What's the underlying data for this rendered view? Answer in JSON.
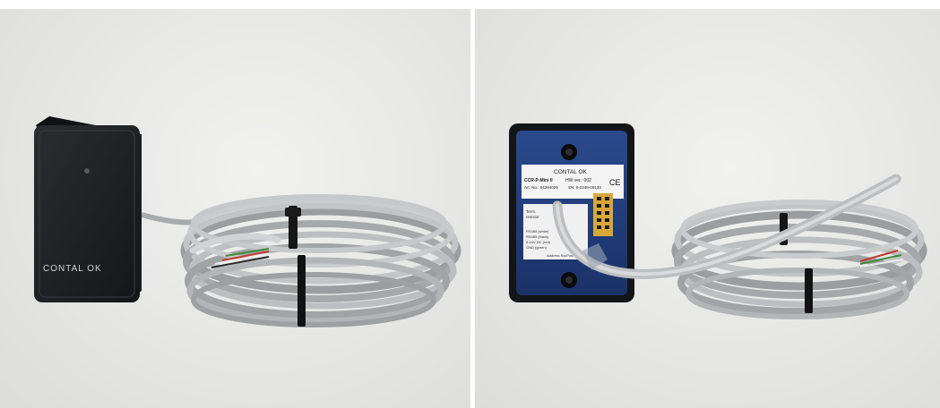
{
  "photo_left": {
    "brand_text": "CONTAL OK"
  },
  "photo_right": {
    "brand_text": "CONTAL OK",
    "label": {
      "model": "CCR-P-Mini II",
      "hw_ver": "HW ver.: 002",
      "art_no": "Art. No.: 64284025",
      "sn": "SN: 0-2248-00133",
      "ce": "CE",
      "term_line1": "Term.",
      "term_line2": "resistor",
      "wire_1": "RS485 (white)",
      "wire_2": "RS485 (black)",
      "wire_3": "5-24V DC (red)",
      "wire_4": "GND (green)",
      "address": "Address Sw.Pos."
    }
  },
  "colors": {
    "background": "#e6e6e5",
    "cable": "#b9babb",
    "reader_body": "#1d1e20",
    "rear_panel": "#233e7a",
    "zip_tie": "#151515"
  }
}
